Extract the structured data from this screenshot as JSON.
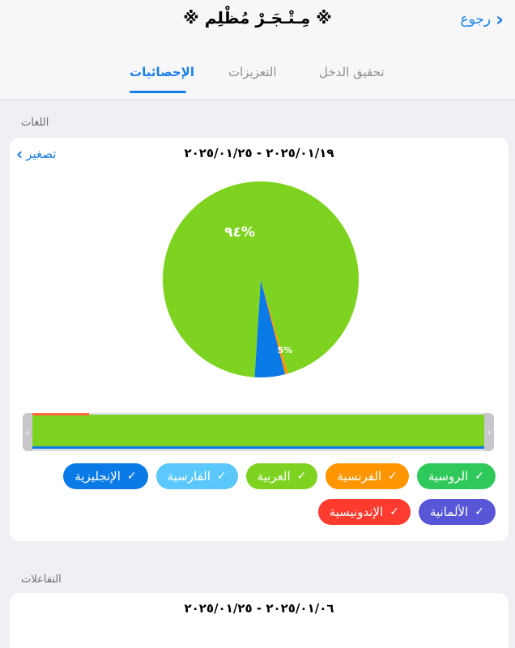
{
  "header": {
    "back_label": "رجوع",
    "title": "※ مِـتْـجَـرْ مُظْلِم ※"
  },
  "tabs": [
    {
      "label": "الإحصائيات",
      "active": true
    },
    {
      "label": "التعزيزات",
      "active": false
    },
    {
      "label": "تحقيق الدخل",
      "active": false
    }
  ],
  "languages": {
    "section_label": "اللغات",
    "zoom_label": "تصغير",
    "date_range": "٢٠٢٥/٠١/١٩ - ٢٠٢٥/٠١/٢٥",
    "slice_labels": {
      "main": "٩٤%",
      "secondary": "5%"
    },
    "legend": [
      {
        "label": "الروسية",
        "color": "#2fc95b"
      },
      {
        "label": "الفرنسية",
        "color": "#ff9500"
      },
      {
        "label": "العربية",
        "color": "#7ed321"
      },
      {
        "label": "الفارسية",
        "color": "#5ac8fa"
      },
      {
        "label": "الإنجليزية",
        "color": "#0a7ae6"
      },
      {
        "label": "الألمانية",
        "color": "#5856d6"
      },
      {
        "label": "الإندونيسية",
        "color": "#ff3b30"
      }
    ]
  },
  "chart_data": {
    "type": "pie",
    "slices": [
      {
        "name": "العربية",
        "value": 94,
        "color": "#7ed321"
      },
      {
        "name": "الإنجليزية",
        "value": 5,
        "color": "#0a7ae6"
      },
      {
        "name": "الفرنسية",
        "value": 0.5,
        "color": "#ff9500"
      }
    ]
  },
  "interactions": {
    "section_label": "التفاعلات",
    "date_range": "٢٠٢٥/٠١/٠٦ - ٢٠٢٥/٠١/٢٥"
  }
}
